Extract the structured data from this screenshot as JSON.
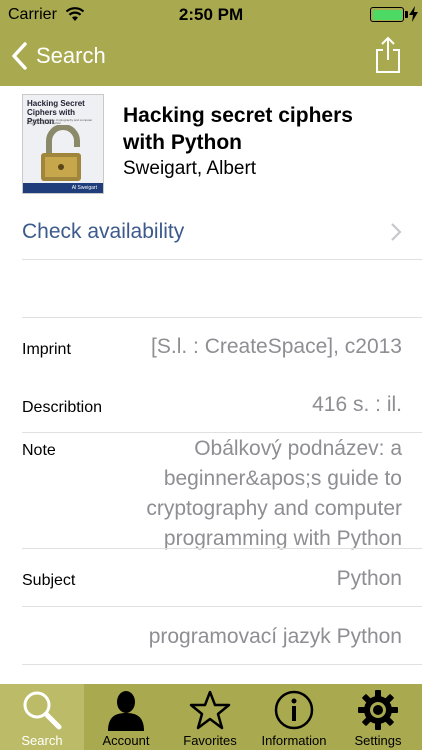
{
  "status_bar": {
    "carrier": "Carrier",
    "time": "2:50 PM"
  },
  "nav": {
    "back_label": "Search"
  },
  "book": {
    "cover_title": "Hacking Secret Ciphers with Python",
    "cover_subtitle": "A beginner's guide to cryptography and computer programming with Python",
    "cover_author": "Al Sweigart",
    "title": "Hacking secret ciphers with Python",
    "author": "Sweigart, Albert"
  },
  "check_availability": "Check availability",
  "details": {
    "imprint_label": "Imprint",
    "imprint_value": "[S.l. : CreateSpace], c2013",
    "description_label": "Describtion",
    "description_value": "416 s. : il.",
    "note_label": "Note",
    "note_value": "Obálkový podnázev: a beginner&apos;s guide to cryptography and computer programming with Python",
    "subject_label": "Subject",
    "subject_value_1": "Python",
    "subject_value_2": "programovací jazyk Python"
  },
  "tabs": [
    {
      "label": "Search",
      "icon": "search-icon",
      "active": true
    },
    {
      "label": "Account",
      "icon": "person-icon",
      "active": false
    },
    {
      "label": "Favorites",
      "icon": "star-icon",
      "active": false
    },
    {
      "label": "Information",
      "icon": "info-icon",
      "active": false
    },
    {
      "label": "Settings",
      "icon": "gear-icon",
      "active": false
    }
  ],
  "colors": {
    "bar": "#a9a94f",
    "active_tab": "#bcbc68",
    "link": "#3c5a8c",
    "value_gray": "#8e8e93",
    "battery": "#4cd964"
  }
}
